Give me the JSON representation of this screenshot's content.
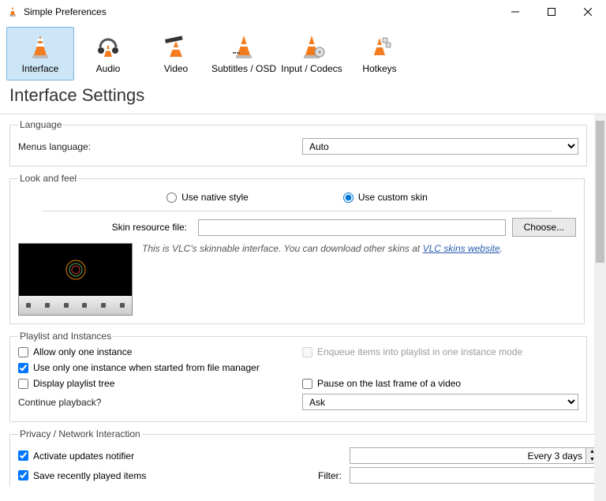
{
  "window": {
    "title": "Simple Preferences"
  },
  "tabs": [
    {
      "label": "Interface",
      "selected": true
    },
    {
      "label": "Audio"
    },
    {
      "label": "Video"
    },
    {
      "label": "Subtitles / OSD"
    },
    {
      "label": "Input / Codecs"
    },
    {
      "label": "Hotkeys"
    }
  ],
  "heading": "Interface Settings",
  "language": {
    "legend": "Language",
    "menus_label": "Menus language:",
    "value": "Auto"
  },
  "look": {
    "legend": "Look and feel",
    "native_label": "Use native style",
    "custom_label": "Use custom skin",
    "selected": "custom",
    "skin_file_label": "Skin resource file:",
    "skin_file_value": "",
    "choose_label": "Choose...",
    "desc_prefix": "This is VLC's skinnable interface. You can download other skins at ",
    "desc_link": "VLC skins website",
    "desc_suffix": "."
  },
  "playlist": {
    "legend": "Playlist and Instances",
    "allow_one": {
      "label": "Allow only one instance",
      "checked": false
    },
    "enqueue": {
      "label": "Enqueue items into playlist in one instance mode",
      "checked": false,
      "disabled": true
    },
    "use_one_fm": {
      "label": "Use only one instance when started from file manager",
      "checked": true
    },
    "display_tree": {
      "label": "Display playlist tree",
      "checked": false
    },
    "pause_last": {
      "label": "Pause on the last frame of a video",
      "checked": false
    },
    "continue_label": "Continue playback?",
    "continue_value": "Ask"
  },
  "privacy": {
    "legend": "Privacy / Network Interaction",
    "updates": {
      "label": "Activate updates notifier",
      "checked": true
    },
    "updates_value": "Every 3 days",
    "save_recent": {
      "label": "Save recently played items",
      "checked": true
    },
    "filter_label": "Filter:",
    "filter_value": ""
  }
}
